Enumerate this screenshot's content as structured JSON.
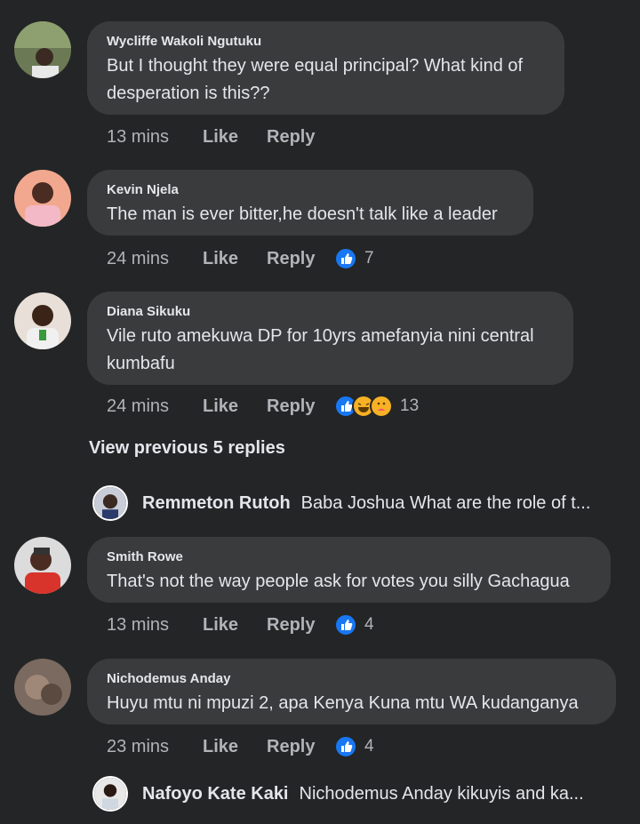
{
  "comments": [
    {
      "author": "Wycliffe Wakoli Ngutuku",
      "text": "But I thought they were equal principal? What kind of desperation is this??",
      "time": "13 mins",
      "like": "Like",
      "reply": "Reply",
      "reactions": ""
    },
    {
      "author": "Kevin Njela",
      "text": "The man is ever bitter,he doesn't talk like a leader",
      "time": "24 mins",
      "like": "Like",
      "reply": "Reply",
      "reactions": "7",
      "reaction_icons": [
        "like-icon"
      ]
    },
    {
      "author": "Diana Sikuku",
      "text": "Vile ruto amekuwa DP for 10yrs amefanyia nini central kumbafu",
      "time": "24 mins",
      "like": "Like",
      "reply": "Reply",
      "reactions": "13",
      "reaction_icons": [
        "like-icon",
        "haha-icon",
        "care-icon"
      ]
    },
    {
      "author": "Smith Rowe",
      "text": "That's not the way people ask for votes you silly Gachagua",
      "time": "13 mins",
      "like": "Like",
      "reply": "Reply",
      "reactions": "4",
      "reaction_icons": [
        "like-icon"
      ]
    },
    {
      "author": "Nichodemus Anday",
      "text": "Huyu mtu ni mpuzi 2, apa Kenya Kuna mtu WA kudanganya",
      "time": "23 mins",
      "like": "Like",
      "reply": "Reply",
      "reactions": "4",
      "reaction_icons": [
        "like-icon"
      ]
    }
  ],
  "view_previous": "View previous 5 replies",
  "collapsed_replies": [
    {
      "author": "Remmeton Rutoh",
      "preview": "Baba Joshua What are the role of t..."
    },
    {
      "author": "Nafoyo Kate Kaki",
      "preview": "Nichodemus Anday kikuyis and ka..."
    }
  ],
  "colors": {
    "background": "#242526",
    "bubble": "#3a3b3c",
    "like_blue": "#1877f2",
    "haha_yellow": "#f7b125"
  }
}
